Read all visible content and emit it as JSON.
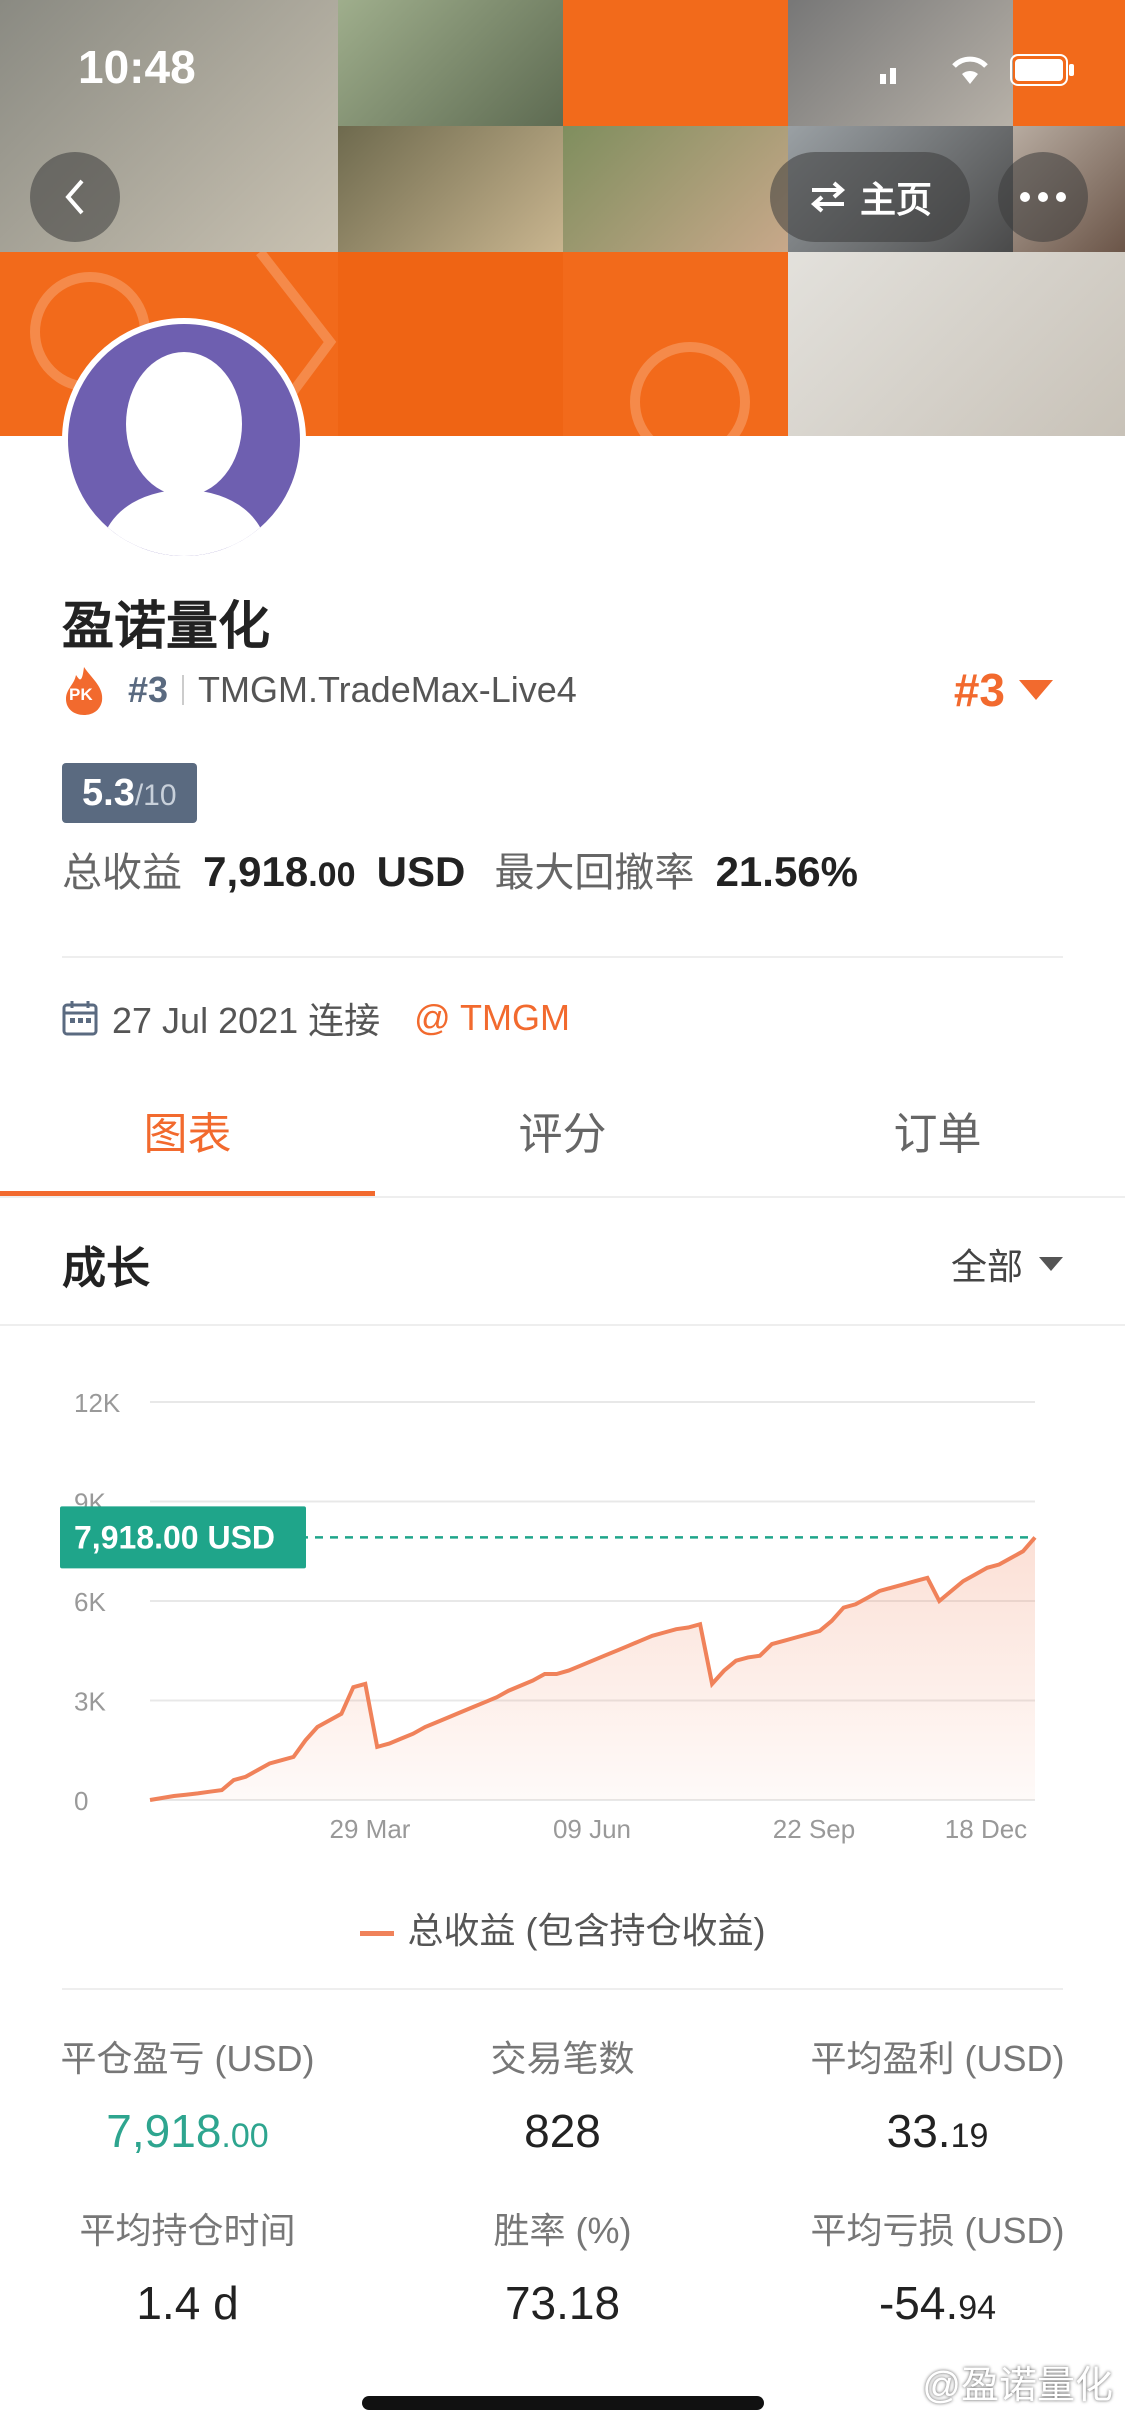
{
  "status_bar": {
    "time": "10:48"
  },
  "header": {
    "home_label": "主页"
  },
  "profile": {
    "name": "盈诺量化",
    "rank": "#3",
    "account": "TMGM.TradeMax-Live4",
    "rank_right": "#3",
    "pk_label": "PK",
    "score": "5.3",
    "score_max": "/10",
    "total_profit_label": "总收益",
    "total_profit_int": "7,918",
    "total_profit_dec": ".00",
    "total_profit_unit": "USD",
    "max_drawdown_label": "最大回撤率",
    "max_drawdown": "21.56%",
    "connect_date": "27 Jul 2021 连接",
    "broker": "@ TMGM"
  },
  "tabs": [
    {
      "label": "图表",
      "active": true
    },
    {
      "label": "评分",
      "active": false
    },
    {
      "label": "订单",
      "active": false
    }
  ],
  "section": {
    "title": "成长",
    "filter": "全部"
  },
  "chart_data": {
    "type": "area",
    "x_ticks": [
      "29 Mar",
      "09 Jun",
      "22 Sep",
      "18 Dec"
    ],
    "y_ticks": [
      "0",
      "3K",
      "6K",
      "9K",
      "12K"
    ],
    "ylim": [
      0,
      12000
    ],
    "current_label": "7,918.00 USD",
    "current_value": 7918,
    "series": [
      {
        "name": "总收益 (包含持仓收益)",
        "color": "#f0825a",
        "values": [
          0,
          60,
          120,
          160,
          200,
          250,
          300,
          600,
          700,
          900,
          1100,
          1200,
          1300,
          1800,
          2200,
          2400,
          2600,
          3400,
          3500,
          1600,
          1700,
          1850,
          2000,
          2200,
          2350,
          2500,
          2650,
          2800,
          2950,
          3100,
          3300,
          3450,
          3600,
          3800,
          3800,
          3900,
          4050,
          4200,
          4350,
          4500,
          4650,
          4800,
          4950,
          5050,
          5150,
          5200,
          5300,
          3500,
          3900,
          4200,
          4300,
          4350,
          4700,
          4800,
          4900,
          5000,
          5100,
          5400,
          5800,
          5900,
          6100,
          6300,
          6400,
          6500,
          6600,
          6700,
          6000,
          6300,
          6600,
          6800,
          7000,
          7100,
          7300,
          7500,
          7918
        ]
      }
    ]
  },
  "legend": {
    "label": "总收益 (包含持仓收益)"
  },
  "stats": [
    {
      "label": "平仓盈亏 (USD)",
      "int": "7,918",
      "dec": ".00",
      "color": "#2ea58f"
    },
    {
      "label": "交易笔数",
      "int": "828",
      "dec": "",
      "color": "#222222"
    },
    {
      "label": "平均盈利 (USD)",
      "int": "33.",
      "dec": "19",
      "color": "#222222"
    },
    {
      "label": "平均持仓时间",
      "int": "1.4 d",
      "dec": "",
      "color": "#222222"
    },
    {
      "label": "胜率 (%)",
      "int": "73.18",
      "dec": "",
      "color": "#222222"
    },
    {
      "label": "平均亏损 (USD)",
      "int": "-54.",
      "dec": "94",
      "color": "#222222"
    }
  ],
  "watermark": "@盈诺量化",
  "colors": {
    "accent": "#f26a2e",
    "teal": "#1fa58a",
    "badge": "#5a6a80"
  }
}
